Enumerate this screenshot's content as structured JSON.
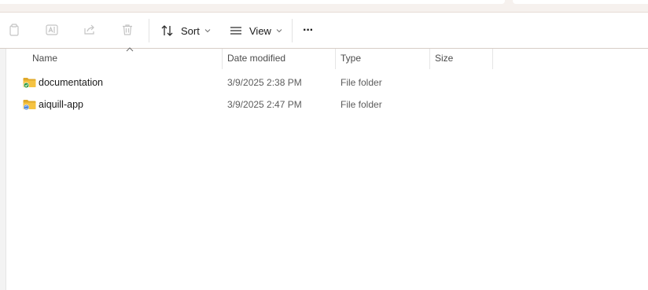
{
  "toolbar": {
    "icons": [
      "copy-icon",
      "rename-icon",
      "share-icon",
      "delete-icon"
    ],
    "sort_label": "Sort",
    "view_label": "View",
    "more_label": "···"
  },
  "columns": {
    "name": "Name",
    "date_modified": "Date modified",
    "type": "Type",
    "size": "Size"
  },
  "rows": [
    {
      "name": "documentation",
      "date_modified": "3/9/2025 2:38 PM",
      "type": "File folder",
      "size": "",
      "icon": "folder-synced-icon",
      "badge_color": "#2e9a3e"
    },
    {
      "name": "aiquill-app",
      "date_modified": "3/9/2025 2:47 PM",
      "type": "File folder",
      "size": "",
      "icon": "folder-syncing-icon",
      "badge_color": "#2a6fd6"
    }
  ],
  "colors": {
    "folder": "#f5c342",
    "folder_dark": "#e0a92a",
    "accent_bg": "#f6f1ee"
  }
}
